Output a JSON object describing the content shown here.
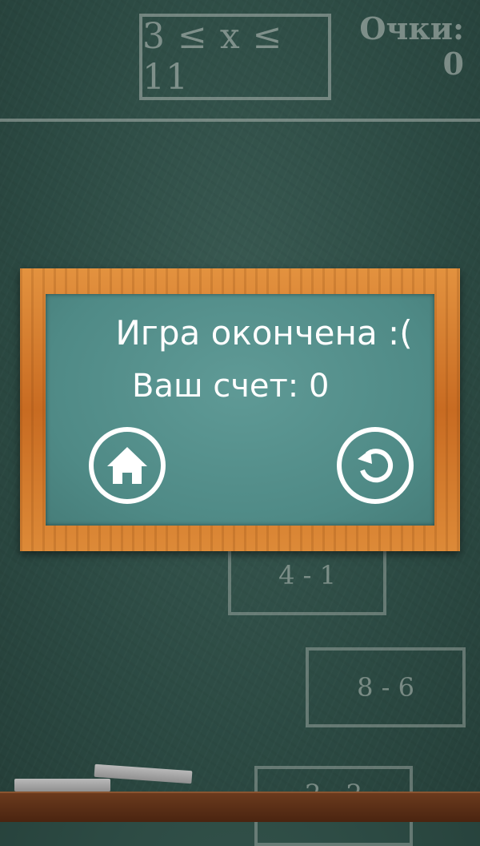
{
  "header": {
    "range_text": "3 ≤ x ≤ 11",
    "score_label": "Очки:",
    "score_value": "0"
  },
  "tiles": [
    {
      "expression": "4 - 1"
    },
    {
      "expression": "8 - 6"
    },
    {
      "expression": "2 - 2"
    }
  ],
  "dialog": {
    "title": "Игра окончена :(",
    "score_text": "Ваш счет: 0",
    "home_icon": "home-icon",
    "restart_icon": "restart-icon"
  },
  "colors": {
    "board": "#2c4a43",
    "frame": "#d07a2c",
    "dialog_board": "#558f8b",
    "chalk_text": "#cdd2cd"
  }
}
